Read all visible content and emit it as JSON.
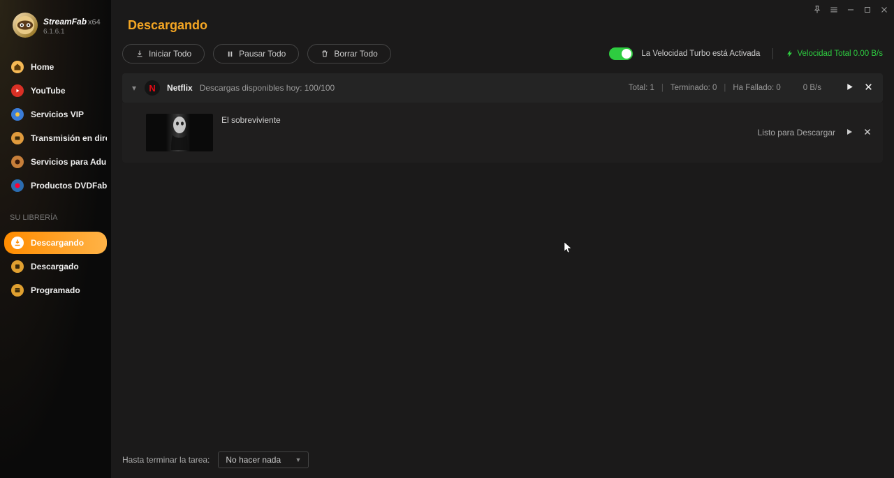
{
  "app": {
    "name": "StreamFab",
    "arch": "x64",
    "version": "6.1.6.1"
  },
  "sidebar": {
    "items": [
      {
        "label": "Home"
      },
      {
        "label": "YouTube"
      },
      {
        "label": "Servicios VIP"
      },
      {
        "label": "Transmisión en dire..."
      },
      {
        "label": "Servicios para Adul..."
      },
      {
        "label": "Productos DVDFab"
      }
    ],
    "library_header": "SU LIBRERÍA",
    "library": [
      {
        "label": "Descargando"
      },
      {
        "label": "Descargado"
      },
      {
        "label": "Programado"
      }
    ]
  },
  "page": {
    "title": "Descargando"
  },
  "toolbar": {
    "start_all": "Iniciar Todo",
    "pause_all": "Pausar Todo",
    "delete_all": "Borrar Todo",
    "turbo_label": "La Velocidad Turbo está Activada",
    "speed_label": "Velocidad Total 0.00 B/s"
  },
  "group": {
    "service_letter": "N",
    "service_name": "Netflix",
    "quota": "Descargas disponibles hoy: 100/100",
    "total": "Total: 1",
    "done": "Terminado: 0",
    "failed": "Ha Fallado: 0",
    "speed": "0 B/s"
  },
  "item": {
    "title": "El sobreviviente",
    "status": "Listo para Descargar"
  },
  "bottom": {
    "label": "Hasta terminar la tarea:",
    "selected": "No hacer nada"
  }
}
